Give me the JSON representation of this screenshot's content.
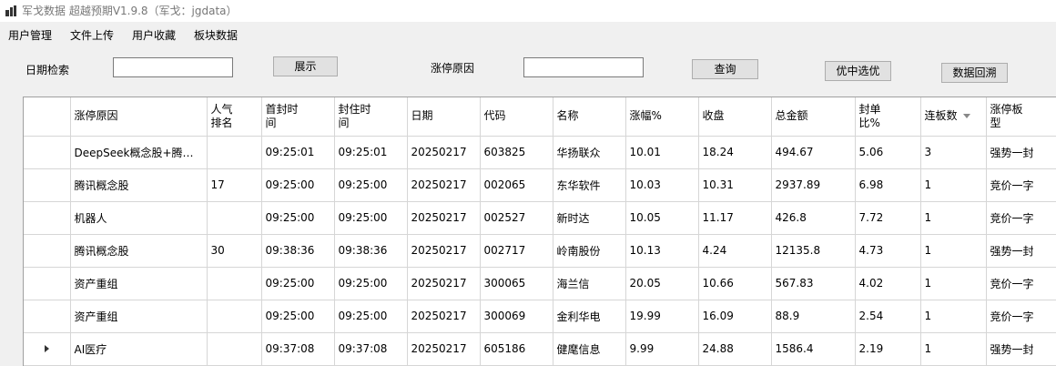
{
  "window": {
    "title": "军戈数据 超越预期V1.9.8（军戈：jgdata）"
  },
  "menu": [
    "用户管理",
    "文件上传",
    "用户收藏",
    "板块数据"
  ],
  "toolbar": {
    "date_label": "日期检索",
    "date_value": "",
    "show_button": "展示",
    "reason_label": "涨停原因",
    "reason_value": "",
    "query_button": "查询",
    "pick_button": "优中选优",
    "backtrack_button": "数据回溯"
  },
  "table": {
    "columns": [
      "涨停原因",
      "人气排名",
      "首封时间",
      "封住时间",
      "日期",
      "代码",
      "名称",
      "涨幅%",
      "收盘",
      "总金额",
      "封单比%",
      "连板数",
      "涨停板型"
    ],
    "headers": [
      [
        "涨停原因"
      ],
      [
        "人气",
        "排名"
      ],
      [
        "首封时",
        "间"
      ],
      [
        "封住时",
        "间"
      ],
      [
        "日期"
      ],
      [
        "代码"
      ],
      [
        "名称"
      ],
      [
        "涨幅%"
      ],
      [
        "收盘"
      ],
      [
        "总金额"
      ],
      [
        "封单",
        "比%"
      ],
      [
        "连板数"
      ],
      [
        "涨停板",
        "型"
      ]
    ],
    "sorted_column": "连板数",
    "current_row": 6,
    "rows": [
      [
        "DeepSeek概念股+腾讯...",
        "",
        "09:25:01",
        "09:25:01",
        "20250217",
        "603825",
        "华扬联众",
        "10.01",
        "18.24",
        "494.67",
        "5.06",
        "3",
        "强势一封"
      ],
      [
        "腾讯概念股",
        "17",
        "09:25:00",
        "09:25:00",
        "20250217",
        "002065",
        "东华软件",
        "10.03",
        "10.31",
        "2937.89",
        "6.98",
        "1",
        "竞价一字"
      ],
      [
        "机器人",
        "",
        "09:25:00",
        "09:25:00",
        "20250217",
        "002527",
        "新时达",
        "10.05",
        "11.17",
        "426.8",
        "7.72",
        "1",
        "竞价一字"
      ],
      [
        "腾讯概念股",
        "30",
        "09:38:36",
        "09:38:36",
        "20250217",
        "002717",
        "岭南股份",
        "10.13",
        "4.24",
        "12135.8",
        "4.73",
        "1",
        "强势一封"
      ],
      [
        "资产重组",
        "",
        "09:25:00",
        "09:25:00",
        "20250217",
        "300065",
        "海兰信",
        "20.05",
        "10.66",
        "567.83",
        "4.02",
        "1",
        "竞价一字"
      ],
      [
        "资产重组",
        "",
        "09:25:00",
        "09:25:00",
        "20250217",
        "300069",
        "金利华电",
        "19.99",
        "16.09",
        "88.9",
        "2.54",
        "1",
        "竞价一字"
      ],
      [
        "AI医疗",
        "",
        "09:37:08",
        "09:37:08",
        "20250217",
        "605186",
        "健麾信息",
        "9.99",
        "24.88",
        "1586.4",
        "2.19",
        "1",
        "强势一封"
      ]
    ]
  }
}
